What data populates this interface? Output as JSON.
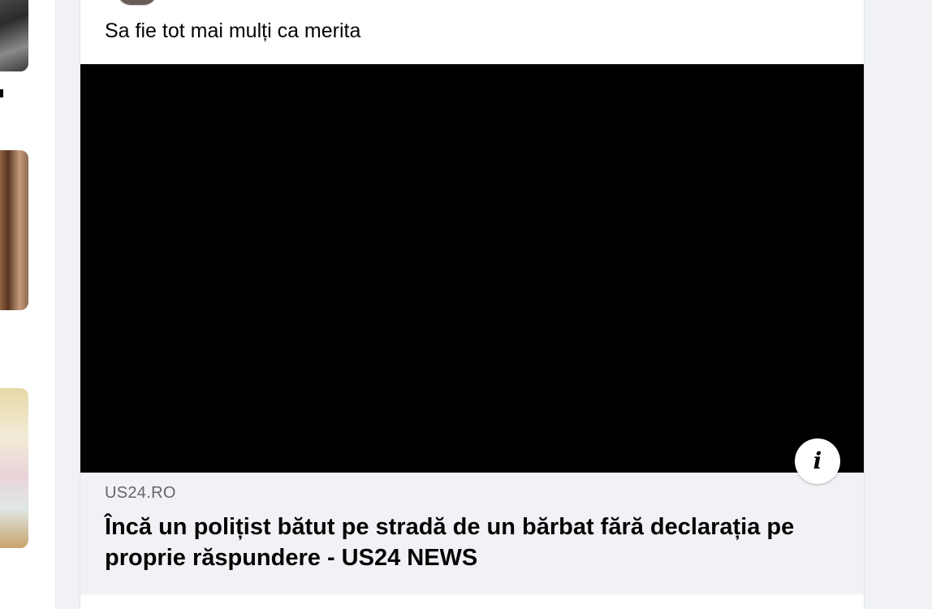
{
  "post": {
    "text": "Sa fie tot mai mulți ca merita",
    "link_preview": {
      "domain": "US24.RO",
      "headline": "Încă un polițist bătut pe stradă de un bărbat fără declarația pe proprie răspundere - US24 NEWS"
    },
    "info_icon": "info-icon"
  },
  "colors": {
    "page_background": "#f0f2f5",
    "card_background": "#ffffff",
    "video_background": "#000000",
    "secondary_text": "#65676b",
    "primary_text": "#050505"
  }
}
